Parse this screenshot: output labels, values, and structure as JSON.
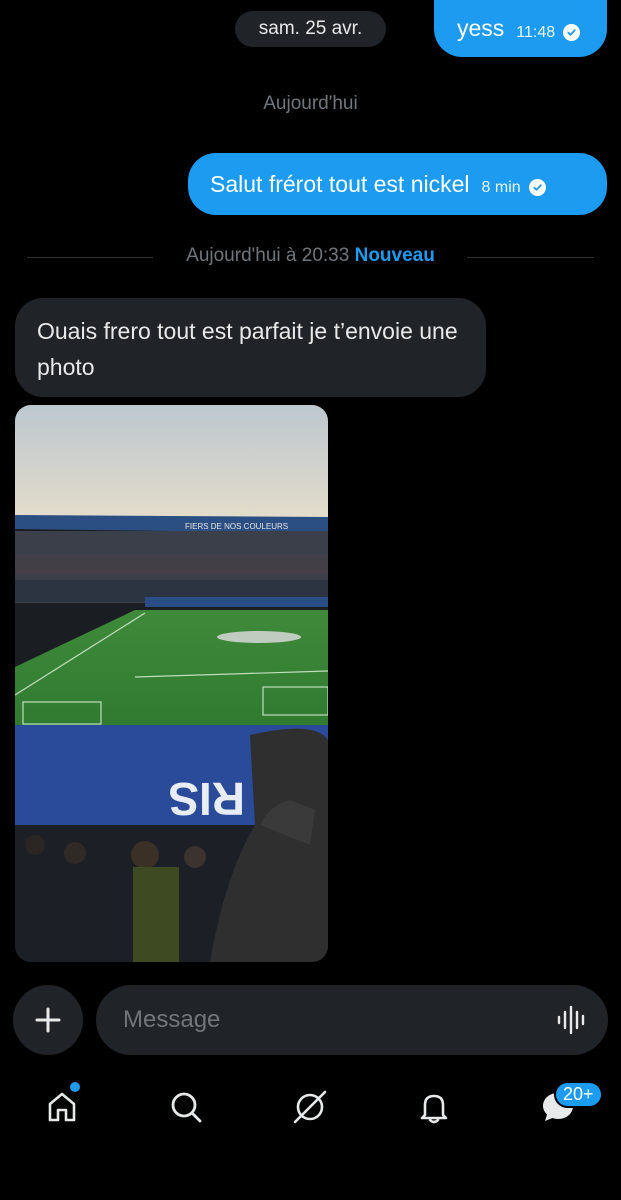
{
  "conversation": {
    "date_pill": "sam. 25 avr.",
    "msg_out_1": {
      "text": "yess",
      "time": "11:48"
    },
    "today_separator": "Aujourd'hui",
    "msg_out_2": {
      "text": "Salut frérot tout est nickel",
      "time": "8 min"
    },
    "new_divider": {
      "time_label": "Aujourd'hui à 20:33",
      "new_label": "Nouveau"
    },
    "msg_in_1": {
      "text": "Ouais frero tout est parfait je t’envoie une photo"
    },
    "photo_ad_text": "FIERS DE NOS COULEURS"
  },
  "composer": {
    "placeholder": "Message"
  },
  "bottom_nav": {
    "items": [
      "home-icon",
      "search-icon",
      "grok-icon",
      "bell-icon",
      "messages-icon"
    ],
    "messages_badge": "20+"
  },
  "colors": {
    "accent": "#1d9bf0",
    "bubble_in": "#202327",
    "background": "#000000"
  }
}
